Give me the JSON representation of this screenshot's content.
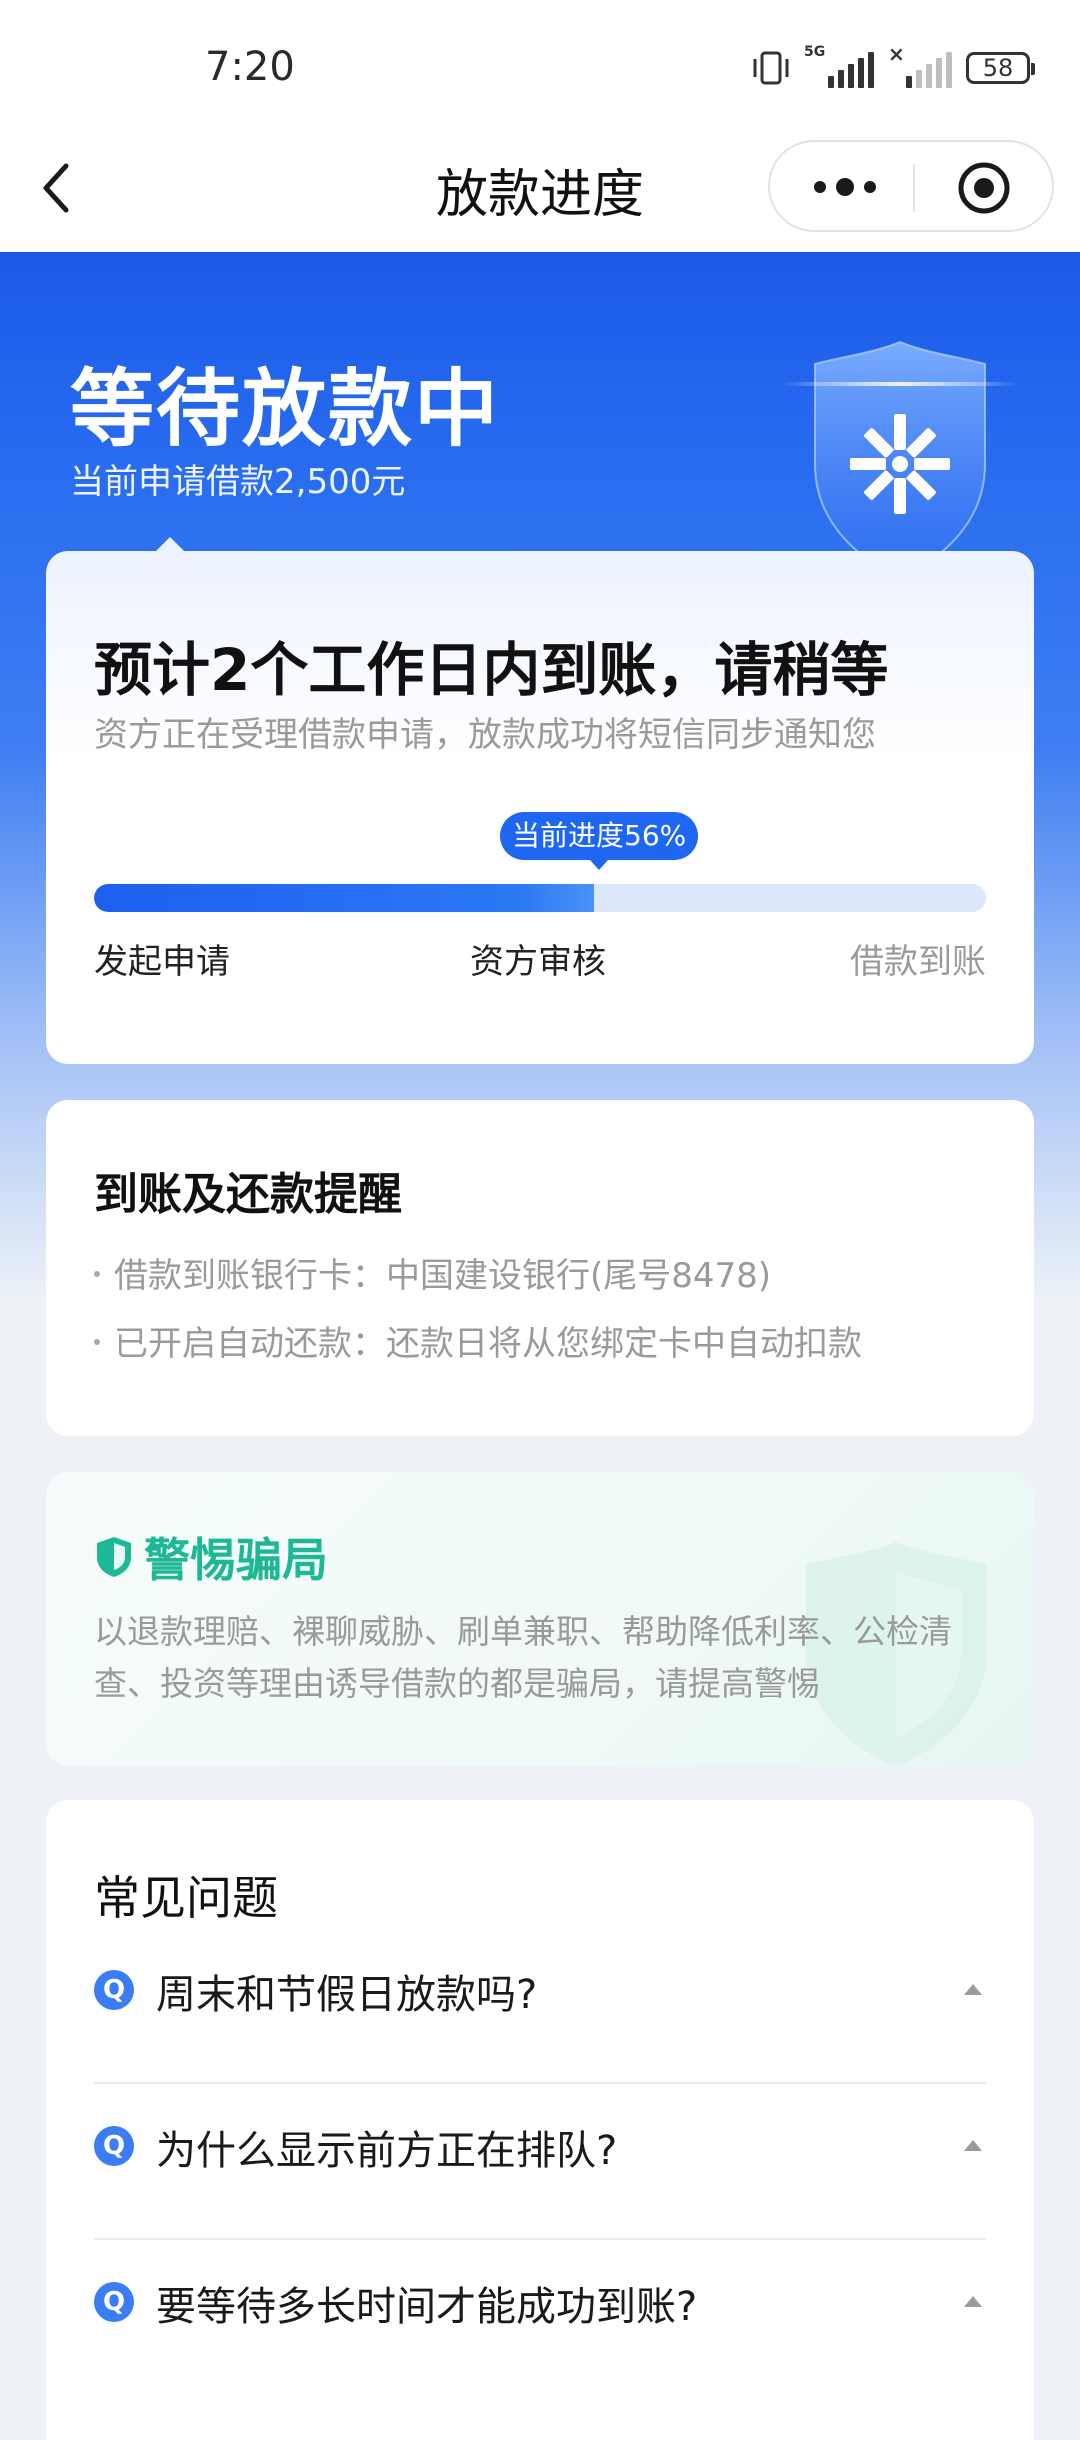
{
  "status_bar": {
    "time": "7:20",
    "network_label": "5G",
    "battery": "58"
  },
  "nav": {
    "title": "放款进度",
    "icons": [
      "back-arrow-icon",
      "more-dots-icon",
      "target-circle-icon"
    ]
  },
  "hero": {
    "title": "等待放款中",
    "subtitle": "当前申请借款2,500元",
    "decoration_icon": "shield-logo-icon"
  },
  "progress_card": {
    "title": "预计2个工作日内到账，请稍等",
    "subtitle": "资方正在受理借款申请，放款成功将短信同步通知您",
    "badge": "当前进度56%",
    "progress_percent": 56,
    "steps": [
      "发起申请",
      "资方审核",
      "借款到账"
    ]
  },
  "reminder_card": {
    "title": "到账及还款提醒",
    "items": [
      "借款到账银行卡：中国建设银行(尾号8478)",
      "已开启自动还款：还款日将从您绑定卡中自动扣款"
    ]
  },
  "fraud_card": {
    "title": "警惕骗局",
    "text": "以退款理赔、裸聊威胁、刷单兼职、帮助降低利率、公检清查、投资等理由诱导借款的都是骗局，请提高警惕",
    "icon": "shield-check-icon"
  },
  "faq": {
    "title": "常见问题",
    "q_icon_label": "Q",
    "items": [
      "周末和节假日放款吗?",
      "为什么显示前方正在排队?",
      "要等待多长时间才能成功到账?"
    ]
  },
  "colors": {
    "primary": "#1f66f2",
    "hero_top": "#1a5ae8",
    "fraud_green": "#1fb897",
    "page_bg": "#eef2f7"
  }
}
